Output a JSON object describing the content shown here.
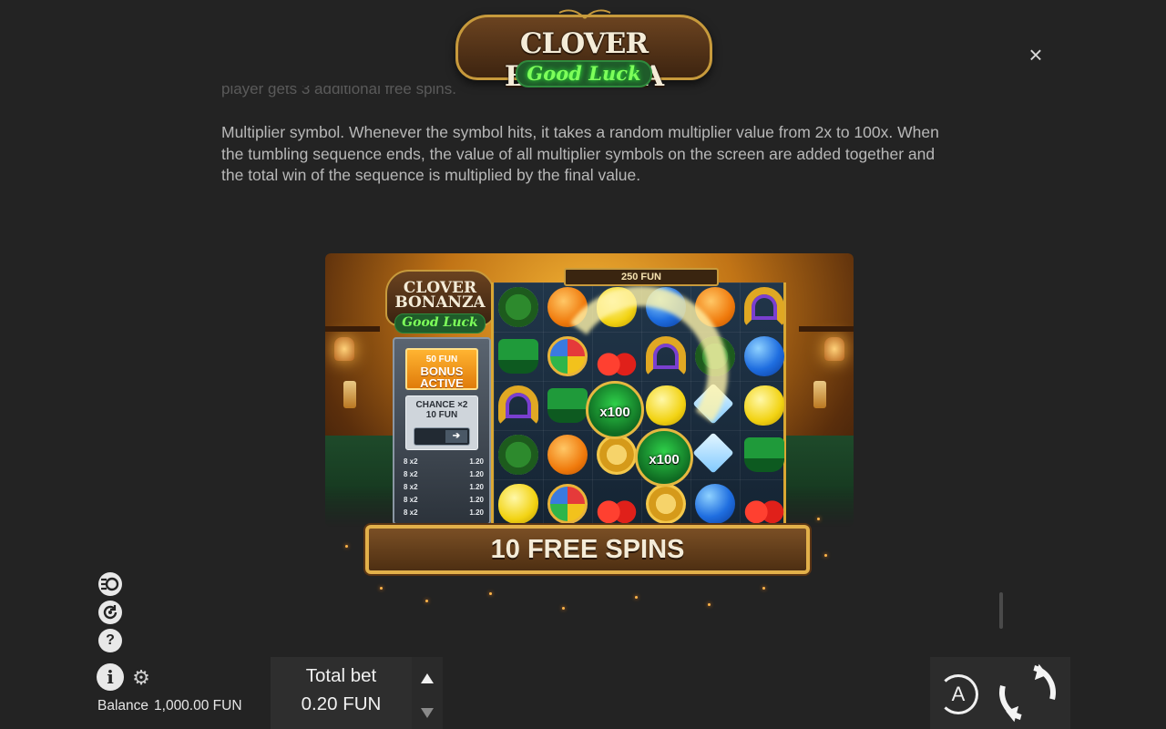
{
  "header": {
    "logo_title": "CLOVER BONANZA",
    "logo_subtitle": "Good Luck",
    "close_label": "×"
  },
  "content": {
    "faded_line": "player gets 3 additional free spins.",
    "multiplier_text": "Multiplier symbol. Whenever the symbol hits, it takes a random multiplier value from 2x to 100x. When the tumbling sequence ends, the value of all multiplier symbols on the screen are added together and the total win of the sequence is multiplied by the final value."
  },
  "illustration": {
    "mini_logo_title": "CLOVER BONANZA",
    "mini_logo_subtitle": "Good Luck",
    "win_banner": "250 FUN",
    "bonus_amount": "50 FUN",
    "bonus_label": "BONUS ACTIVE",
    "chance_label": "CHANCE ×2",
    "chance_amount": "10 FUN",
    "paytable": [
      {
        "combo": "8 x2",
        "value": "1.20"
      },
      {
        "combo": "8 x2",
        "value": "1.20"
      },
      {
        "combo": "8 x2",
        "value": "1.20"
      },
      {
        "combo": "8 x2",
        "value": "1.20"
      },
      {
        "combo": "8 x2",
        "value": "1.20"
      }
    ],
    "multipliers": [
      "x100",
      "x100"
    ],
    "free_spins_banner": "10 FREE SPINS"
  },
  "controls": {
    "balance_label": "Balance",
    "balance_value": "1,000.00 FUN",
    "total_bet_label": "Total bet",
    "total_bet_value": "0.20 FUN",
    "autoplay_letter": "A"
  },
  "icons": {
    "stake": "coin-stack-icon",
    "history": "history-icon",
    "help": "help-icon",
    "info": "info-icon",
    "settings": "gear-icon"
  },
  "colors": {
    "background": "#232323",
    "text": "#b8b8b8",
    "accent_gold": "#d9a733",
    "accent_green": "#7dff5a"
  }
}
